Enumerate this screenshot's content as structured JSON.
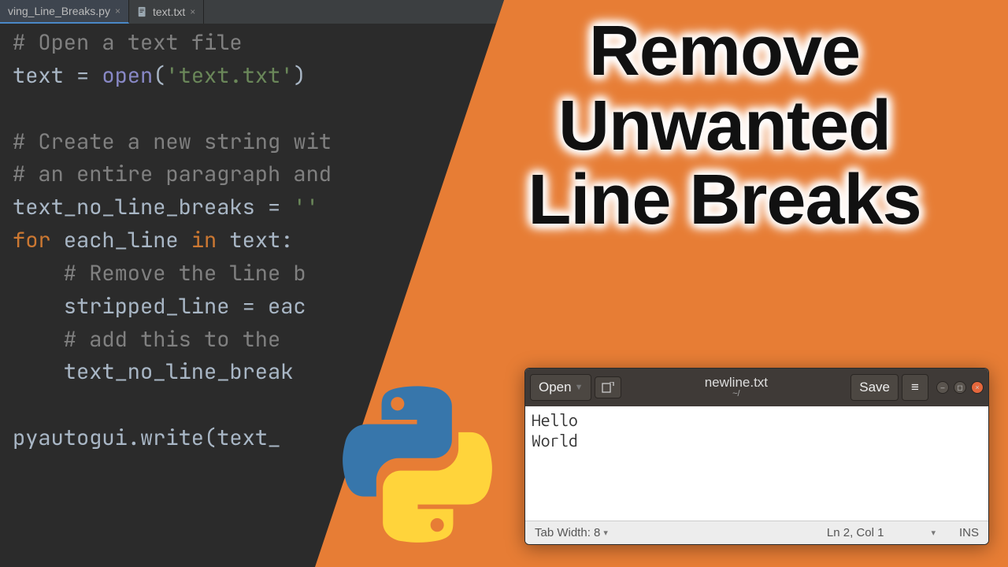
{
  "editor": {
    "tabs": [
      {
        "name": "ving_Line_Breaks.py",
        "active": true
      },
      {
        "name": "text.txt",
        "active": false
      }
    ],
    "code": {
      "l1": "# Open a text file",
      "l2a": "text ",
      "l2b": "= ",
      "l2c": "open",
      "l2d": "(",
      "l2e": "'text.txt'",
      "l2f": ")",
      "l3": "",
      "l4": "# Create a new string wit",
      "l5": "# an entire paragraph and",
      "l6a": "text_no_line_breaks ",
      "l6b": "= ",
      "l6c": "''",
      "l7a": "for ",
      "l7b": "each_line ",
      "l7c": "in ",
      "l7d": "text:",
      "l8": "    # Remove the line b",
      "l9a": "    stripped_line ",
      "l9b": "= eac",
      "l10": "    # add this to the ",
      "l11": "    text_no_line_break",
      "l12": "",
      "l13a": "pyautogui.write(text_"
    }
  },
  "headline": {
    "line1": "Remove",
    "line2": "Unwanted",
    "line3": "Line Breaks"
  },
  "gedit": {
    "open_label": "Open",
    "title": "newline.txt",
    "subtitle": "~/",
    "save_label": "Save",
    "content_l1": "Hello",
    "content_l2": "World",
    "status": {
      "tab_width": "Tab Width: 8",
      "position": "Ln 2, Col 1",
      "mode": "INS"
    }
  }
}
